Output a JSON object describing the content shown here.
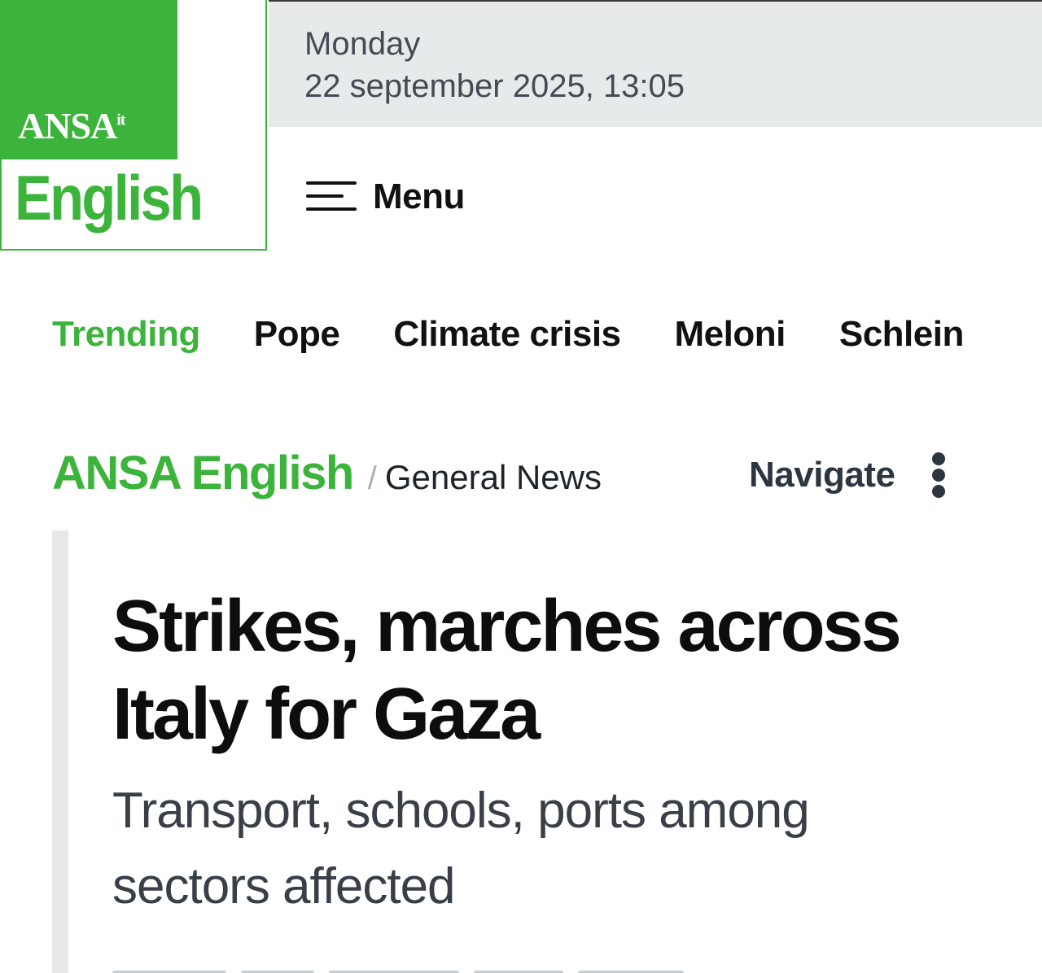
{
  "header": {
    "logo_text": "ANSA",
    "logo_suffix": "it",
    "logo_edition": "English",
    "date_day": "Monday",
    "date_full": "22 september 2025, 13:05",
    "menu_label": "Menu",
    "brand_color": "#3cb43c"
  },
  "trending": {
    "label": "Trending",
    "items": [
      "Pope",
      "Climate crisis",
      "Meloni",
      "Schlein"
    ]
  },
  "breadcrumb": {
    "home": "ANSA English",
    "separator": "/",
    "section": "General News",
    "navigate_label": "Navigate"
  },
  "article": {
    "headline": "Strikes, marches across Italy for Gaza",
    "subheadline": "Transport, schools, ports among sectors affected"
  },
  "icons": {
    "menu": "hamburger-menu-icon",
    "navigate": "vertical-dots-icon"
  }
}
